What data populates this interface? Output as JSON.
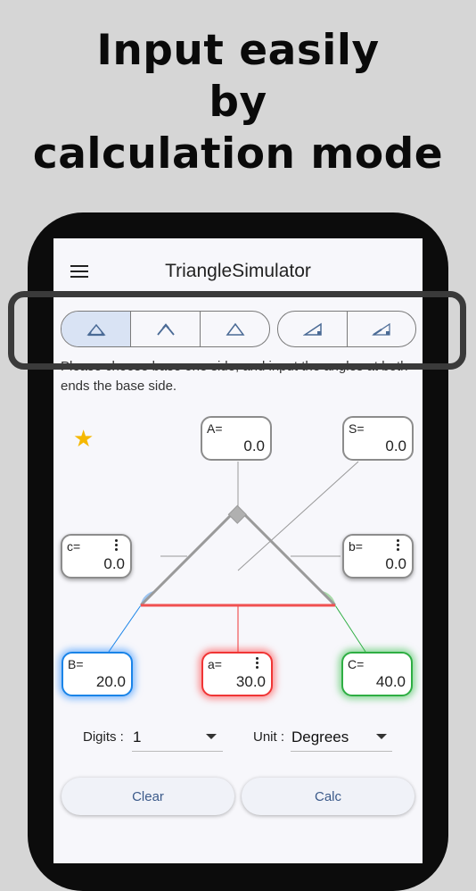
{
  "headline": {
    "line1": "Input easily",
    "line2": "by",
    "line3": "calculation mode"
  },
  "app": {
    "title": "TriangleSimulator",
    "menu_icon": "hamburger-menu-icon"
  },
  "modes": [
    {
      "icon": "triangle-base-angles-icon",
      "selected": true
    },
    {
      "icon": "triangle-apex-icon",
      "selected": false
    },
    {
      "icon": "triangle-sides-icon",
      "selected": false
    },
    {
      "icon": "right-triangle-angle-icon",
      "selected": false
    },
    {
      "icon": "right-triangle-side-icon",
      "selected": false
    }
  ],
  "instruction": "Please choose base one side, and input the angles at both ends the base side.",
  "favorite_icon": "star-icon",
  "fields": {
    "A": {
      "label": "A=",
      "value": "0.0"
    },
    "S": {
      "label": "S=",
      "value": "0.0"
    },
    "c": {
      "label": "c=",
      "value": "0.0"
    },
    "b": {
      "label": "b=",
      "value": "0.0"
    },
    "B": {
      "label": "B=",
      "value": "20.0"
    },
    "a": {
      "label": "a=",
      "value": "30.0"
    },
    "C": {
      "label": "C=",
      "value": "40.0"
    }
  },
  "colors": {
    "angle_B": "#1a84e8",
    "side_a": "#f03535",
    "angle_C": "#2eae43"
  },
  "digits": {
    "label": "Digits :",
    "value": "1"
  },
  "unit": {
    "label": "Unit :",
    "value": "Degrees"
  },
  "buttons": {
    "clear": "Clear",
    "calc": "Calc"
  }
}
